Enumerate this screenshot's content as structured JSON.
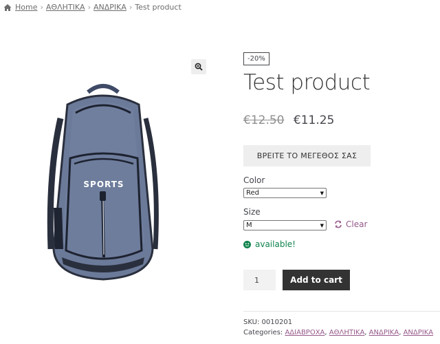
{
  "breadcrumb": {
    "home": "Home",
    "items": [
      "ΑΘΛΗΤΙΚΑ",
      "ΑΝΔΡΙΚΑ"
    ],
    "current": "Test product",
    "separator": "›"
  },
  "gallery": {
    "zoom_icon": "zoom-in-icon",
    "image_text": "SPORTS"
  },
  "product": {
    "sale_badge": "-20%",
    "title": "Test product",
    "price_old": "€12.50",
    "price_new": "€11.25",
    "size_guide_label": "ΒΡΕΙΤΕ ΤΟ ΜΕΓΕΘΟΣ ΣΑΣ",
    "color_label": "Color",
    "color_value": "Red",
    "size_label": "Size",
    "size_value": "M",
    "clear_label": "Clear",
    "stock_text": "available!",
    "quantity": "1",
    "add_to_cart": "Add to cart",
    "sku_label": "SKU:",
    "sku_value": "0010201",
    "categories_label": "Categories:",
    "categories": [
      "ΑΔΙΑΒΡΟΧΑ",
      "ΑΘΛΗΤΙΚΑ",
      "ΑΝΔΡΙΚΑ",
      "ΑΝΔΡΙΚΑ"
    ]
  },
  "colors": {
    "accent": "#96588a",
    "stock": "#0f834d",
    "button_dark": "#333333",
    "backpack": "#6b7a99"
  }
}
